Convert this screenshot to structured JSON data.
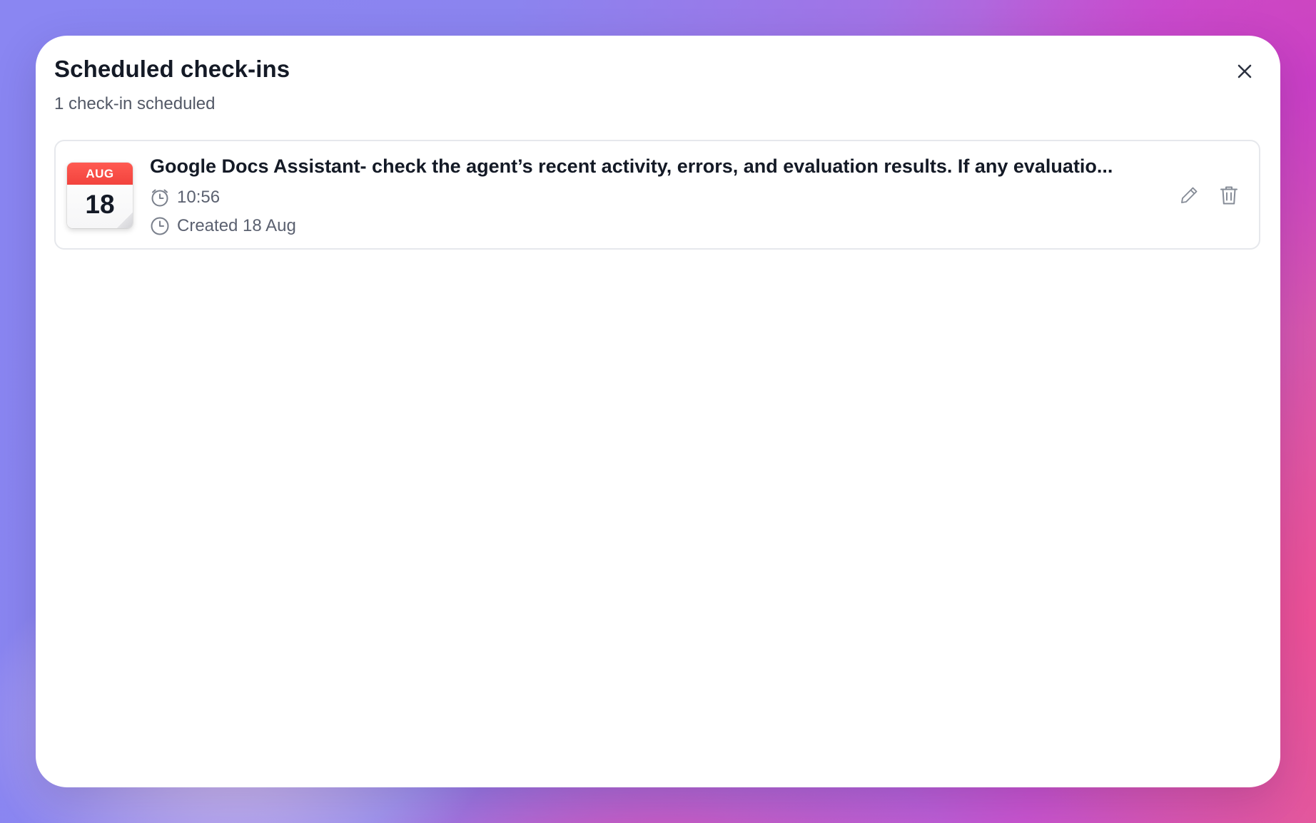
{
  "modal": {
    "title": "Scheduled check-ins",
    "subtitle": "1 check-in scheduled",
    "close_icon": "close-icon"
  },
  "checkins": [
    {
      "calendar": {
        "month": "AUG",
        "day": "18"
      },
      "title": "Google Docs Assistant- check the agent’s recent activity, errors, and evaluation results. If any evaluatio...",
      "time": "10:56",
      "created": "Created 18 Aug",
      "icons": {
        "time": "alarm-clock-icon",
        "created": "clock-icon",
        "edit": "pencil-icon",
        "delete": "trash-icon"
      }
    }
  ],
  "colors": {
    "calendar_header": "#f2433d",
    "title_text": "#141a26",
    "secondary_text": "#5b6170",
    "card_border": "#e6e8ec"
  }
}
